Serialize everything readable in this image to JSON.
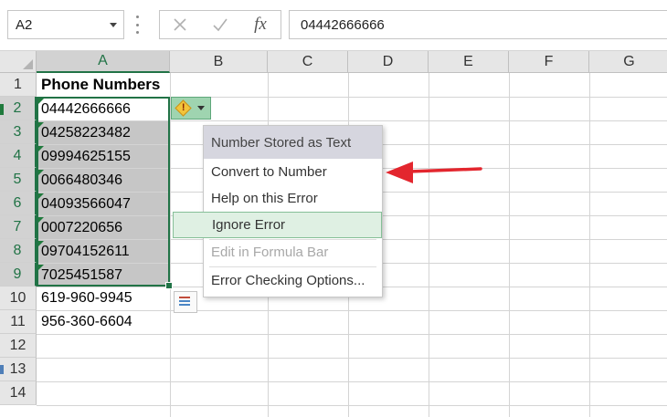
{
  "formula_bar": {
    "name_box": "A2",
    "cancel_icon": "close-icon",
    "enter_icon": "check-icon",
    "fx_label": "fx",
    "formula_value": "04442666666"
  },
  "columns": [
    "A",
    "B",
    "C",
    "D",
    "E",
    "F",
    "G"
  ],
  "selected_column": "A",
  "rows": [
    "1",
    "2",
    "3",
    "4",
    "5",
    "6",
    "7",
    "8",
    "9",
    "10",
    "11",
    "12",
    "13",
    "14"
  ],
  "cells": {
    "A1": "Phone Numbers",
    "A2": "04442666666",
    "A3": "04258223482",
    "A4": "09994625155",
    "A5": "0066480346",
    "A6": "04093566047",
    "A7": "0007220656",
    "A8": "09704152611",
    "A9": "7025451587",
    "A10": "619-960-9945",
    "A11": "956-360-6604"
  },
  "error_menu": {
    "title": "Number Stored as Text",
    "items": [
      {
        "label": "Convert to Number",
        "state": "normal"
      },
      {
        "label": "Help on this Error",
        "state": "normal"
      },
      {
        "label": "Ignore Error",
        "state": "highlighted"
      },
      {
        "label": "Edit in Formula Bar",
        "state": "disabled"
      },
      {
        "label": "Error Checking Options...",
        "state": "normal"
      }
    ]
  },
  "smart_tag": {
    "icon": "warning-diamond-icon",
    "dropdown_icon": "chevron-down-icon"
  },
  "annotation": {
    "icon": "red-arrow-icon",
    "color": "#e3262e"
  },
  "colors": {
    "excel_green": "#217346",
    "selection_gray": "#c6c6c6",
    "menu_highlight": "#dff0e3"
  }
}
